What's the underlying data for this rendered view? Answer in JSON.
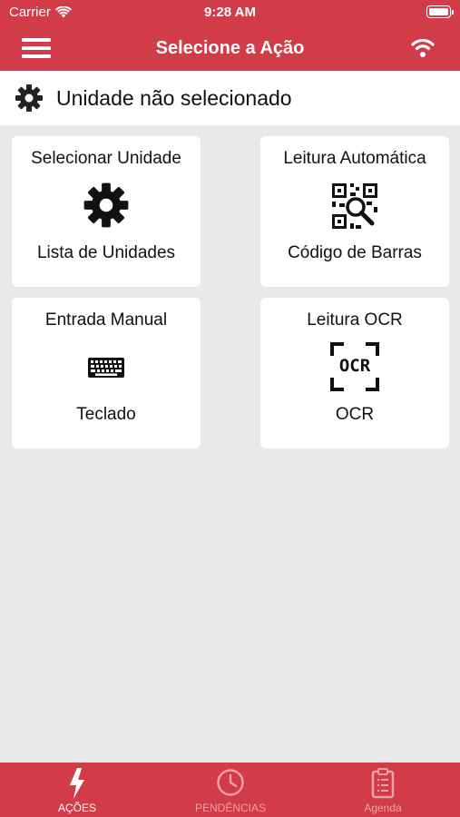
{
  "status_bar": {
    "carrier": "Carrier",
    "time": "9:28 AM"
  },
  "nav": {
    "title": "Selecione a Ação"
  },
  "unit": {
    "label": "Unidade não selecionado"
  },
  "cards": [
    {
      "title": "Selecionar Unidade",
      "subtitle": "Lista de Unidades",
      "icon": "gear-icon"
    },
    {
      "title": "Leitura Automática",
      "subtitle": "Código de Barras",
      "icon": "qr-code-icon"
    },
    {
      "title": "Entrada Manual",
      "subtitle": "Teclado",
      "icon": "keyboard-icon"
    },
    {
      "title": "Leitura OCR",
      "subtitle": "OCR",
      "icon": "ocr-icon",
      "icon_text": "OCR"
    }
  ],
  "tabs": [
    {
      "label": "AÇÕES",
      "icon": "lightning-icon",
      "active": true
    },
    {
      "label": "PENDÊNCIAS",
      "icon": "clock-icon",
      "active": false
    },
    {
      "label": "Agenda",
      "icon": "clipboard-icon",
      "active": false
    }
  ],
  "colors": {
    "brand": "#d23b48",
    "background": "#e9e9e9",
    "card": "#ffffff",
    "inactive_tab": "#eba1a8"
  }
}
